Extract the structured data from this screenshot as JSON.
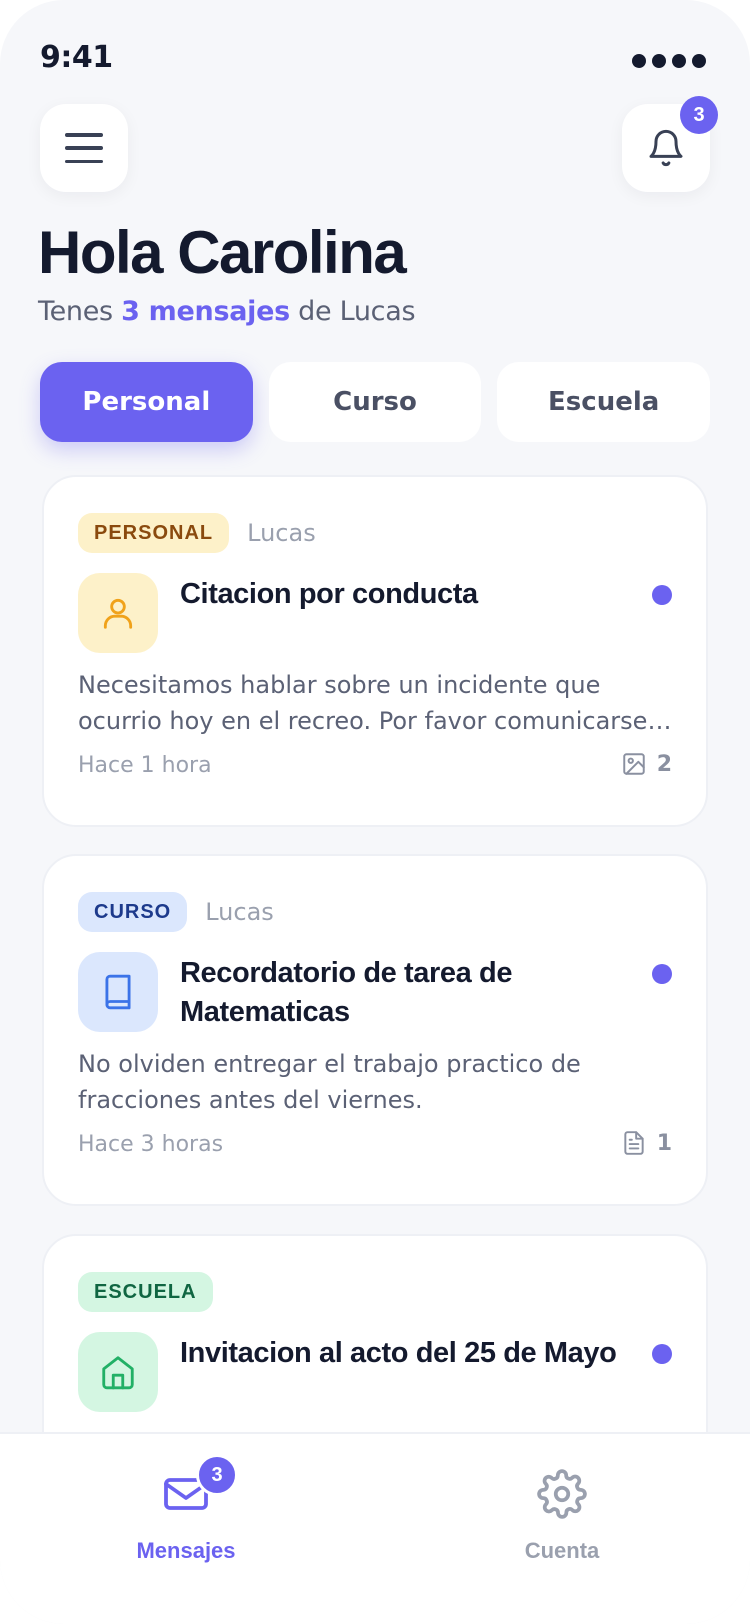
{
  "status_bar": {
    "time": "9:41"
  },
  "header": {
    "notification_count": "3"
  },
  "greeting": {
    "title": "Hola Carolina",
    "subtitle_prefix": "Tenes ",
    "subtitle_highlight": "3 mensajes",
    "subtitle_suffix": " de Lucas"
  },
  "tabs": [
    {
      "label": "Personal",
      "active": true
    },
    {
      "label": "Curso",
      "active": false
    },
    {
      "label": "Escuela",
      "active": false
    }
  ],
  "messages": [
    {
      "category": "PERSONAL",
      "sender": "Lucas",
      "icon": "user-icon",
      "title": "Citacion por conducta",
      "body": "Necesitamos hablar sobre un incidente que ocurrio hoy en el recreo. Por favor comunicarse con la escuela.",
      "time": "Hace 1 hora",
      "attachment_icon": "image-icon",
      "attachment_count": "2",
      "unread": true
    },
    {
      "category": "CURSO",
      "sender": "Lucas",
      "icon": "book-icon",
      "title": "Recordatorio de tarea de Matematicas",
      "body": "No olviden entregar el trabajo practico de fracciones antes del viernes.",
      "time": "Hace 3 horas",
      "attachment_icon": "document-icon",
      "attachment_count": "1",
      "unread": true
    },
    {
      "category": "ESCUELA",
      "sender": "",
      "icon": "school-icon",
      "title": "Invitacion al acto del 25 de Mayo",
      "unread": true
    }
  ],
  "bottom_nav": {
    "messages_label": "Mensajes",
    "messages_badge": "3",
    "account_label": "Cuenta"
  },
  "colors": {
    "accent": "#6b62f0",
    "personal_bg": "#fdf1c9",
    "curso_bg": "#dbe7fd",
    "escuela_bg": "#d4f6e2"
  }
}
